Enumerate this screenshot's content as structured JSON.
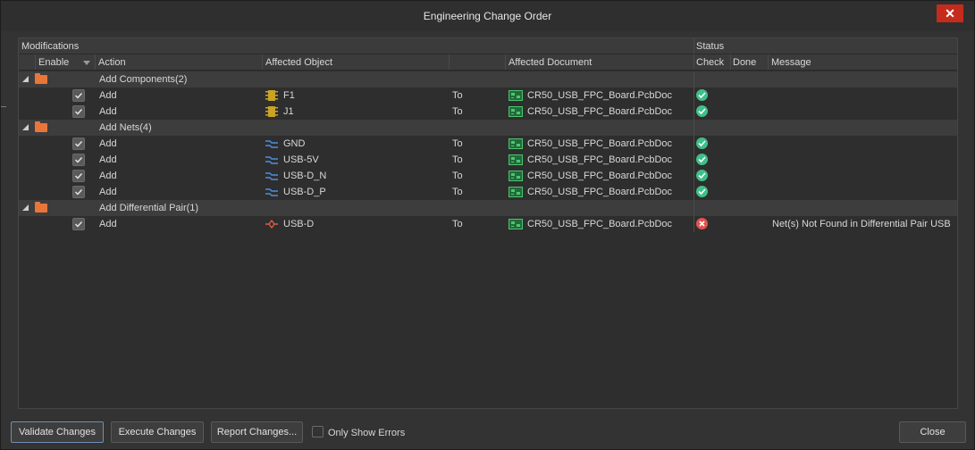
{
  "window": {
    "title": "Engineering Change Order",
    "close_glyph": "✕"
  },
  "grid": {
    "header_groups": {
      "modifications": "Modifications",
      "status": "Status"
    },
    "columns": {
      "enable": "Enable",
      "action": "Action",
      "affected_object": "Affected Object",
      "affected_document": "Affected Document",
      "check": "Check",
      "done": "Done",
      "message": "Message"
    },
    "groups": [
      {
        "label": "Add Components(2)",
        "rows": [
          {
            "enabled": true,
            "action": "Add",
            "object": "F1",
            "object_icon": "component-icon",
            "to": "To",
            "document": "CR50_USB_FPC_Board.PcbDoc",
            "check": "ok",
            "message": ""
          },
          {
            "enabled": true,
            "action": "Add",
            "object": "J1",
            "object_icon": "component-icon",
            "to": "To",
            "document": "CR50_USB_FPC_Board.PcbDoc",
            "check": "ok",
            "message": ""
          }
        ]
      },
      {
        "label": "Add Nets(4)",
        "rows": [
          {
            "enabled": true,
            "action": "Add",
            "object": "GND",
            "object_icon": "net-icon",
            "to": "To",
            "document": "CR50_USB_FPC_Board.PcbDoc",
            "check": "ok",
            "message": ""
          },
          {
            "enabled": true,
            "action": "Add",
            "object": "USB-5V",
            "object_icon": "net-icon",
            "to": "To",
            "document": "CR50_USB_FPC_Board.PcbDoc",
            "check": "ok",
            "message": ""
          },
          {
            "enabled": true,
            "action": "Add",
            "object": "USB-D_N",
            "object_icon": "net-icon",
            "to": "To",
            "document": "CR50_USB_FPC_Board.PcbDoc",
            "check": "ok",
            "message": ""
          },
          {
            "enabled": true,
            "action": "Add",
            "object": "USB-D_P",
            "object_icon": "net-icon",
            "to": "To",
            "document": "CR50_USB_FPC_Board.PcbDoc",
            "check": "ok",
            "message": ""
          }
        ]
      },
      {
        "label": "Add Differential Pair(1)",
        "rows": [
          {
            "enabled": true,
            "action": "Add",
            "object": "USB-D",
            "object_icon": "diff-pair-icon",
            "to": "To",
            "document": "CR50_USB_FPC_Board.PcbDoc",
            "check": "error",
            "message": "Net(s) Not Found in Differential Pair USB"
          }
        ]
      }
    ]
  },
  "footer": {
    "validate": "Validate Changes",
    "execute": "Execute Changes",
    "report": "Report Changes...",
    "only_errors": "Only Show Errors",
    "close": "Close"
  },
  "colors": {
    "ok": "#3fbf8a",
    "error": "#e2534d",
    "folder": "#e8763a"
  }
}
